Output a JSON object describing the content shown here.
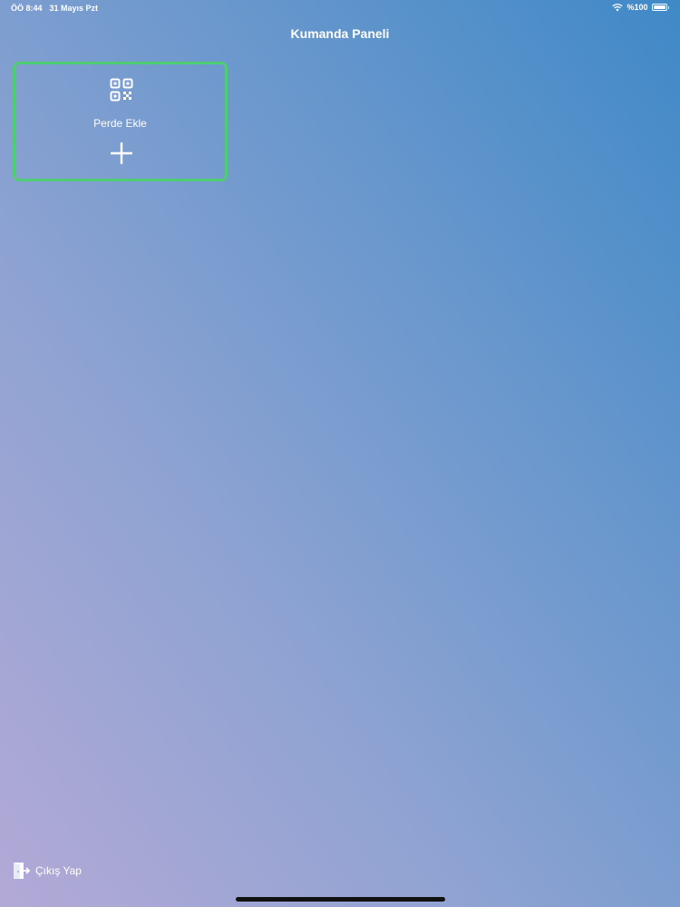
{
  "status_bar": {
    "time": "ÖÖ 8:44",
    "date": "31 Mayıs Pzt",
    "battery": "%100",
    "wifi_icon": "wifi-icon",
    "battery_icon": "battery-icon"
  },
  "header": {
    "title": "Kumanda Paneli"
  },
  "add_card": {
    "label": "Perde Ekle",
    "top_icon": "qr-code-icon",
    "bottom_icon": "plus-icon",
    "border_color": "#4fcd72"
  },
  "logout": {
    "label": "Çıkış Yap",
    "icon": "door-exit-icon"
  },
  "colors": {
    "gradient_top_right": "#3f89c7",
    "gradient_bottom_left": "#b3a9d6",
    "accent_green": "#4fcd72"
  }
}
